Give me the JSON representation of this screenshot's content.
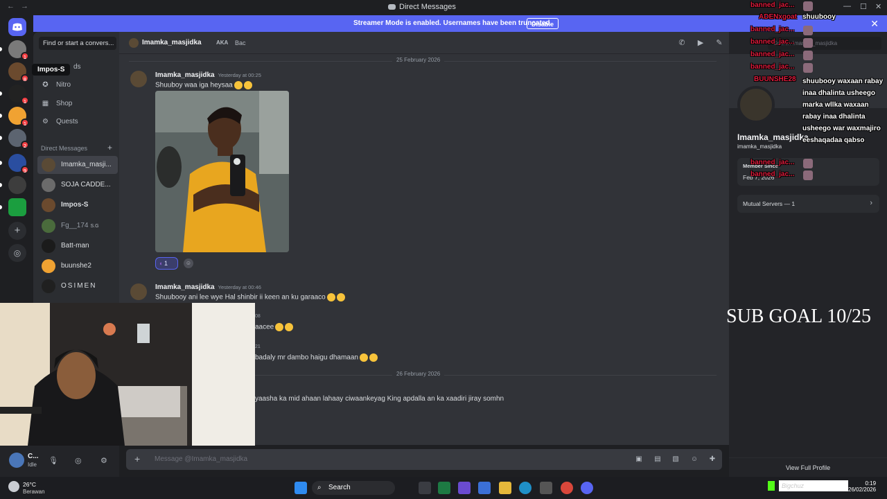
{
  "window": {
    "title": "Direct Messages",
    "back": "←",
    "forward": "→"
  },
  "banner": {
    "message": "Streamer Mode is enabled. Usernames have been truncated.",
    "disable_label": "Disable"
  },
  "servers": [
    {
      "badge": ""
    },
    {
      "badge": "1"
    },
    {
      "badge": "8"
    },
    {
      "badge": "1"
    },
    {
      "badge": "1"
    },
    {
      "badge": "2"
    },
    {
      "badge": "9"
    },
    {
      "badge": ""
    },
    {
      "badge": ""
    }
  ],
  "sidebar": {
    "find_placeholder": "Find or start a convers...",
    "nav": [
      {
        "label": "Friends",
        "icon": "friends-icon"
      },
      {
        "label": "Nitro",
        "icon": "nitro-icon"
      },
      {
        "label": "Shop",
        "icon": "shop-icon"
      },
      {
        "label": "Quests",
        "icon": "quests-icon"
      }
    ],
    "tooltip": "Impos-S",
    "friends_visible": "ds",
    "dm_header": "Direct Messages",
    "dm_add": "+",
    "dms": [
      {
        "name": "Imamka_masji...",
        "tag": "",
        "color": "#5a4a35"
      },
      {
        "name": "SOJA CADDE...",
        "tag": "",
        "color": "#6b6b6b"
      },
      {
        "name": "Impos-S",
        "tag": "",
        "color": "#6b4a2e"
      },
      {
        "name": "Fg__174",
        "tag": "S.G",
        "color": "#4a6b3c"
      },
      {
        "name": "Batt-man",
        "tag": "",
        "color": "#1b1b1b"
      },
      {
        "name": "buunshe2",
        "tag": "",
        "color": "#f0a232"
      },
      {
        "name": "OSIMEN",
        "tag": "",
        "color": "#202020"
      }
    ]
  },
  "header": {
    "name": "Imamka_masjidka",
    "aka_label": "AKA",
    "aka_value": "Bac",
    "search_placeholder": "Search Imamka_masjidka"
  },
  "messages": {
    "date1": "25 February 2026",
    "m1": {
      "author": "Imamka_masjidka",
      "time": "Yesterday at 00:25",
      "text": "Shuuboy waa iga heysaa"
    },
    "reaction_count": "1",
    "m2": {
      "author": "Imamka_masjidka",
      "time": "Yesterday at 00:46",
      "text": "Shuubooy ani lee wye Hal shinbir ii keen an ku garaaco"
    },
    "m3_text": "aacee",
    "m3_time": "08",
    "m4_text": "badaly mr dambo haigu dhamaan",
    "m4_time": "21",
    "date2": "26 February 2026",
    "m5_text": "yaasha ka mid ahaan lahaay ciwaankeyag King apdalla an ka xaadiri jiray somhn"
  },
  "composer": {
    "placeholder": "Message @Imamka_masjidka"
  },
  "user_panel": {
    "name": "C...",
    "status": "Idle"
  },
  "profile": {
    "display_name": "Imamka_masjidka",
    "username": "imamka_masjidka",
    "member_since_label": "Member Since",
    "member_since_value": "Feb 7, 2026",
    "mutual_servers": "Mutual Servers — 1",
    "view_full": "View Full Profile"
  },
  "overlay": {
    "chat": [
      {
        "user": "banned_jac...",
        "text": "",
        "color": "#e01b3c"
      },
      {
        "user": "ADENxgoat",
        "text": "shuubooy",
        "color": "#e01b3c"
      },
      {
        "user": "banned_jac...",
        "text": "",
        "color": "#e01b3c"
      },
      {
        "user": "banned_jac...",
        "text": "",
        "color": "#e01b3c"
      },
      {
        "user": "banned_jac...",
        "text": "",
        "color": "#e01b3c"
      },
      {
        "user": "banned_jac...",
        "text": "",
        "color": "#e01b3c"
      },
      {
        "user": "BUUNSHE28",
        "text": "shuubooy waxaan rabay inaa dhalinta usheego marka wllka waxaan rabay inaa dhalinta usheego war waxmajiro eeshaqadaa qabso",
        "color": "#e01b3c"
      },
      {
        "user": "banned_jac...",
        "text": "",
        "color": "#e01b3c"
      },
      {
        "user": "banned_jac...",
        "text": "",
        "color": "#e01b3c"
      }
    ],
    "sub_goal": "SUB GOAL 10/25"
  },
  "taskbar": {
    "temp": "26°C",
    "condition": "Berawan",
    "search": "Search",
    "time": "0:19",
    "date": "26/02/2026",
    "tray_text": "Bigchuz"
  }
}
